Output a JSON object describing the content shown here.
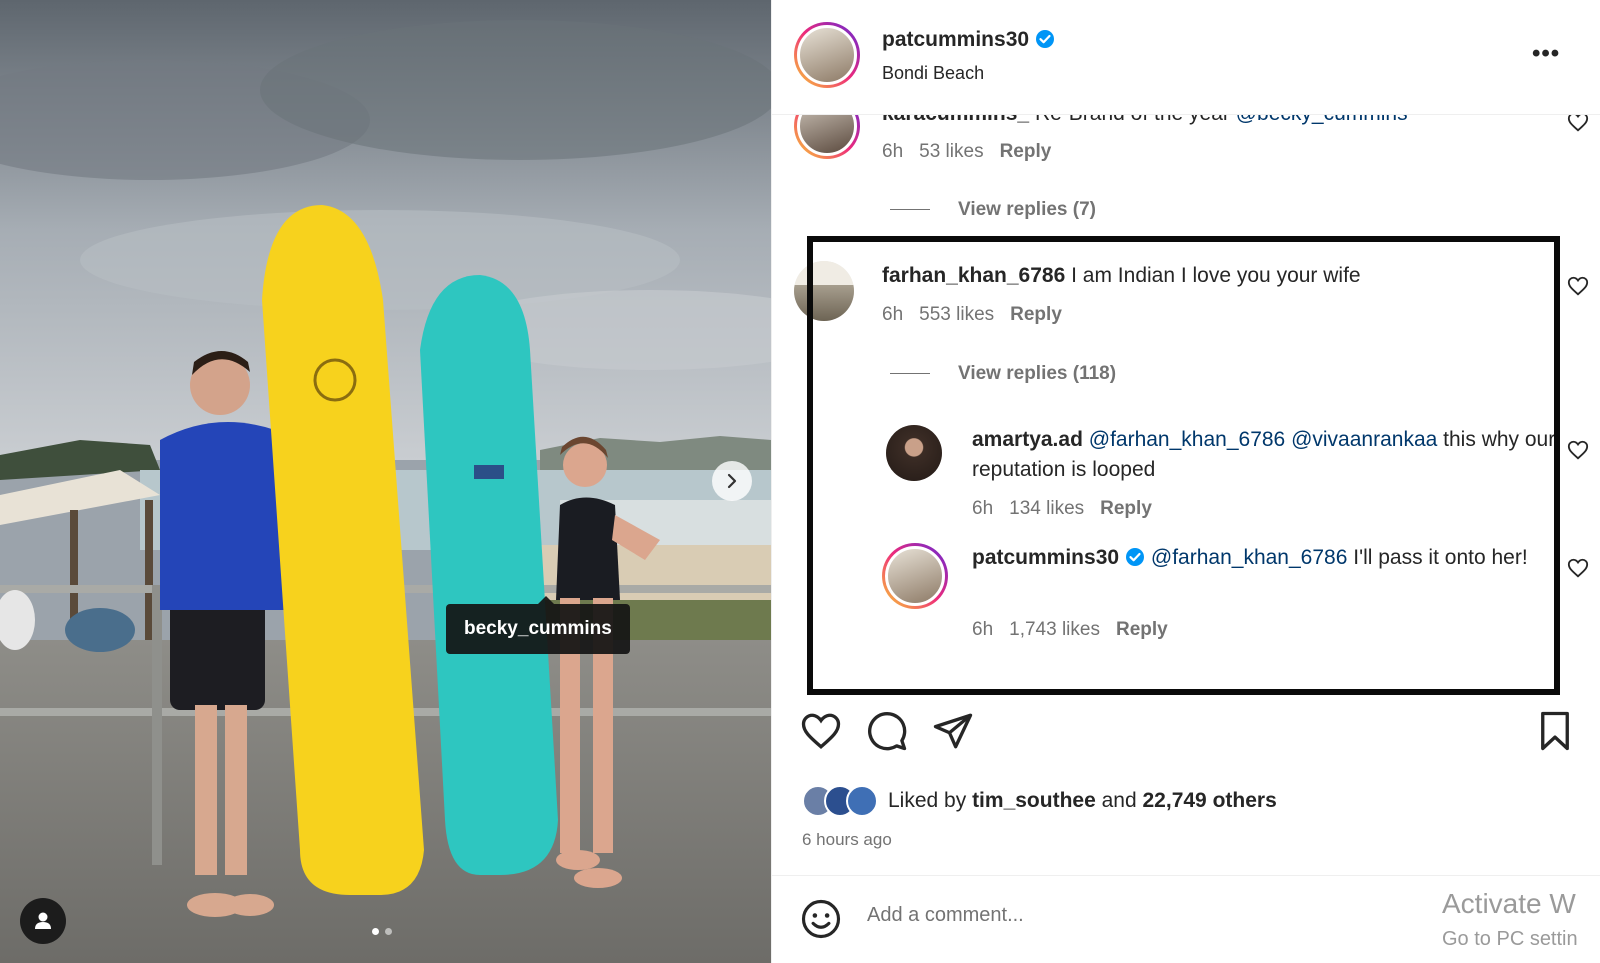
{
  "photo": {
    "tagged_user": "becky_cummins",
    "carousel_dots": 2,
    "carousel_active": 0
  },
  "post": {
    "author": "patcummins30",
    "location": "Bondi Beach",
    "verified": true
  },
  "comments": [
    {
      "username": "karacummins_",
      "text": "Re-Brand of the year",
      "mention": "@becky_cummins",
      "time": "6h",
      "likes": "53 likes",
      "reply": "Reply",
      "view_replies": "View replies (7)"
    },
    {
      "username": "farhan_khan_6786",
      "text": "I am Indian I love you your wife",
      "time": "6h",
      "likes": "553 likes",
      "reply": "Reply",
      "view_replies": "View replies (118)"
    }
  ],
  "replies": [
    {
      "username": "amartya.ad",
      "mention1": "@farhan_khan_6786",
      "mention2": "@vivaanrankaa",
      "text_line1": "this",
      "text_line2": "why our reputation is looped",
      "time": "6h",
      "likes": "134 likes",
      "reply": "Reply"
    },
    {
      "username": "patcummins30",
      "verified": true,
      "mention": "@farhan_khan_6786",
      "text_line1": "I'll pass it onto",
      "text_line2": "her!",
      "time": "6h",
      "likes": "1,743 likes",
      "reply": "Reply"
    }
  ],
  "engagement": {
    "liked_by_prefix": "Liked by",
    "liked_by_user": "tim_southee",
    "liked_by_and": "and",
    "liked_by_count": "22,749 others",
    "time_ago": "6 hours ago"
  },
  "composer": {
    "placeholder": "Add a comment..."
  },
  "watermark": {
    "line1": "Activate W",
    "line2": "Go to PC settin"
  },
  "colors": {
    "link": "#00376b",
    "muted": "#737373",
    "verified": "#0095f6",
    "highlight_box": "#0a0a0a"
  },
  "icons": [
    "verified-badge-icon",
    "more-options-icon",
    "heart-icon",
    "comment-icon",
    "share-icon",
    "save-icon",
    "emoji-icon",
    "user-tag-icon",
    "chevron-right-icon"
  ]
}
